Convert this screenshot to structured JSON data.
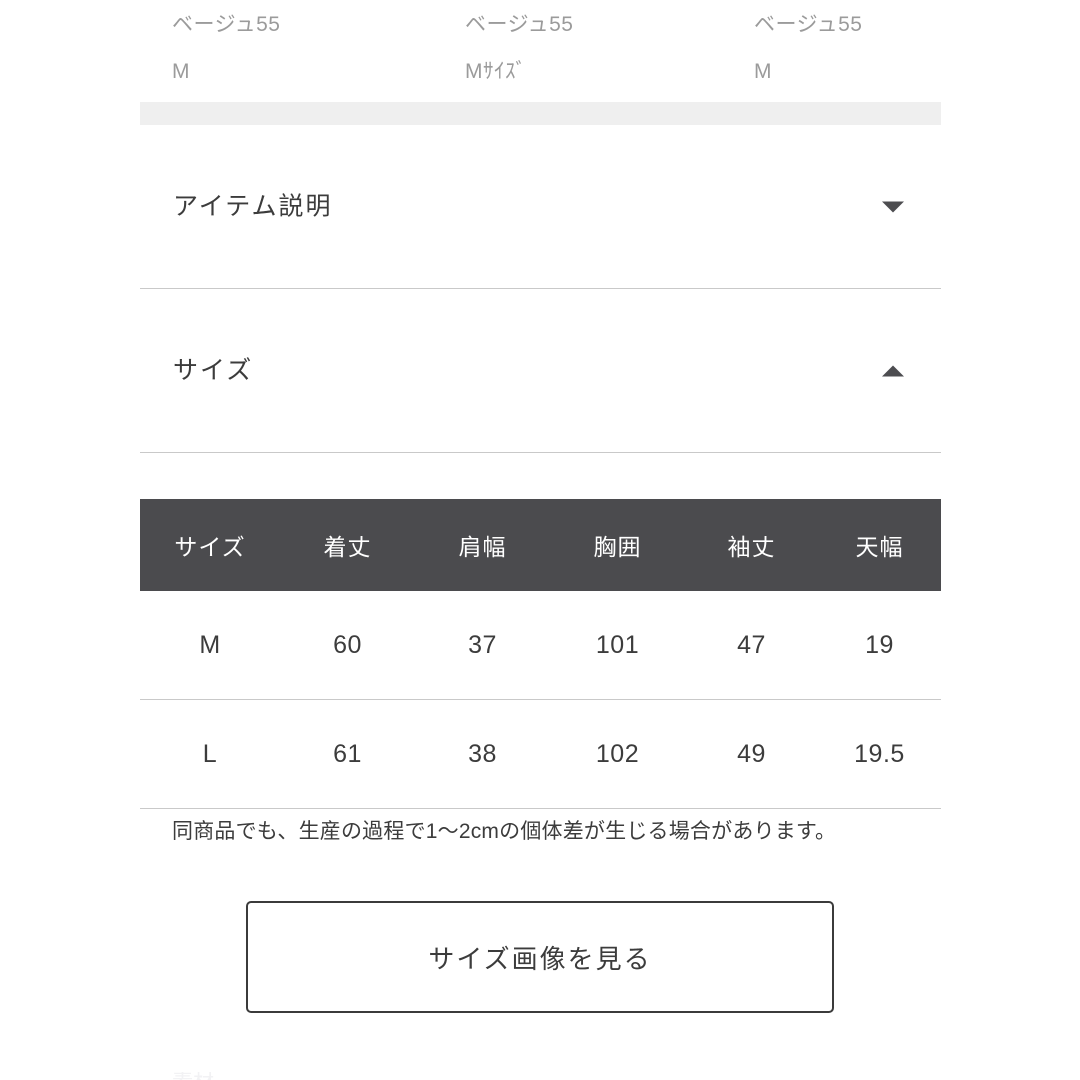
{
  "variants": [
    {
      "color": "ベージュ55",
      "size": "M"
    },
    {
      "color": "ベージュ55",
      "size": "Mｻｲｽﾞ"
    },
    {
      "color": "ベージュ55",
      "size": "M"
    }
  ],
  "accordions": [
    {
      "label": "アイテム説明",
      "state": "collapsed",
      "icon": "chevron-down-icon"
    },
    {
      "label": "サイズ",
      "state": "expanded",
      "icon": "chevron-up-icon"
    }
  ],
  "size_table": {
    "headers": [
      "サイズ",
      "着丈",
      "肩幅",
      "胸囲",
      "袖丈",
      "天幅"
    ],
    "rows": [
      {
        "size": "M",
        "length": "60",
        "shoulder": "37",
        "chest": "101",
        "sleeve": "47",
        "top_width": "19"
      },
      {
        "size": "L",
        "length": "61",
        "shoulder": "38",
        "chest": "102",
        "sleeve": "49",
        "top_width": "19.5"
      }
    ]
  },
  "note": "同商品でも、生産の過程で1〜2cmの個体差が生じる場合があります。",
  "size_image_button": {
    "label": "サイズ画像を見る"
  },
  "bottom_cut_text": "素材",
  "colors": {
    "page_background": "#ffffff",
    "gray_band": "#efefef",
    "table_header_bg": "#4b4b4e",
    "table_header_text": "#ffffff",
    "body_text": "#3c3c3c",
    "muted_text": "#9b9b9b",
    "rule": "#c9c9c9",
    "button_border": "#3b3b3b"
  }
}
